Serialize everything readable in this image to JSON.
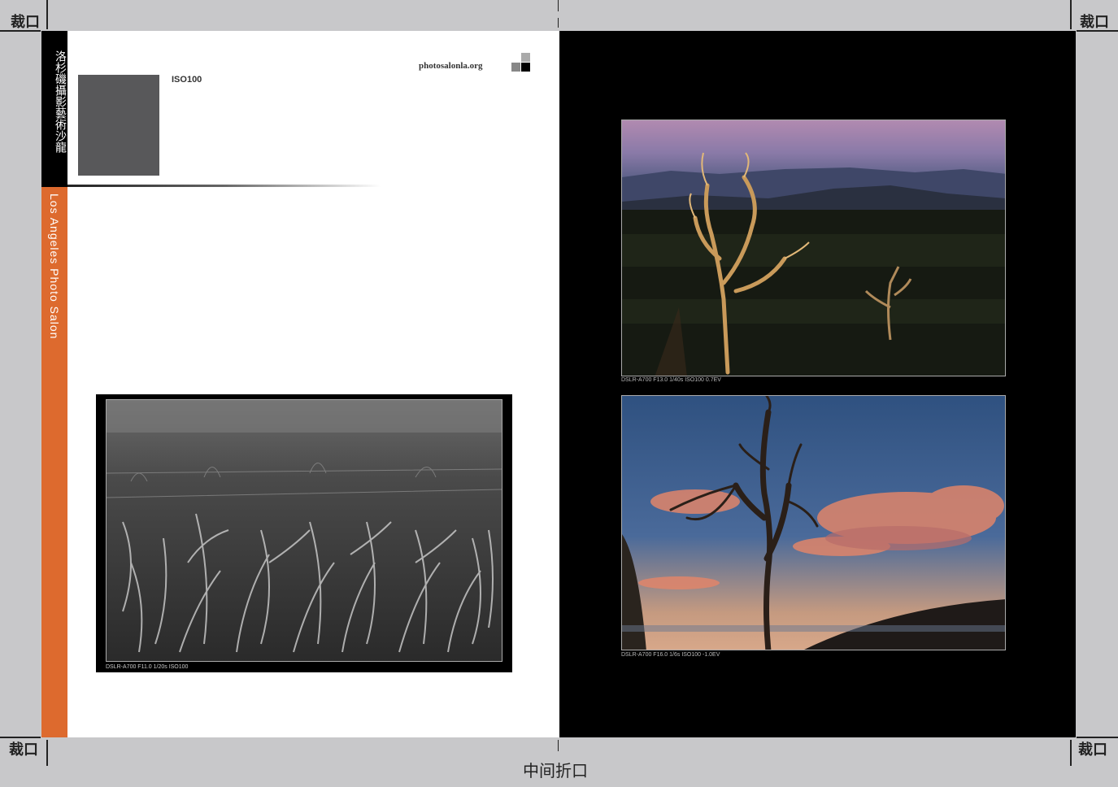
{
  "crop_marks": {
    "top_left": "裁口",
    "top_right": "裁口",
    "bottom_left": "裁口",
    "bottom_right": "裁口",
    "fold": "中间折口"
  },
  "left_page": {
    "spine_chinese": "洛杉磯攝影藝術沙龍",
    "spine_english": "Los Angeles Photo Salon",
    "iso_label": "ISO100",
    "brand": "photosalonla.org",
    "bw_caption": "DSLR-A700 F11.0 1/20s ISO100",
    "colors": {
      "spine_black": "#000000",
      "spine_orange": "#dd6a2e",
      "placeholder": "#58585a"
    }
  },
  "right_page": {
    "photo1_caption": "DSLR-A700 F13.0 1/40s ISO100 0.7EV",
    "photo2_caption": "DSLR-A700 F16.0 1/6s ISO100 -1.0EV"
  }
}
